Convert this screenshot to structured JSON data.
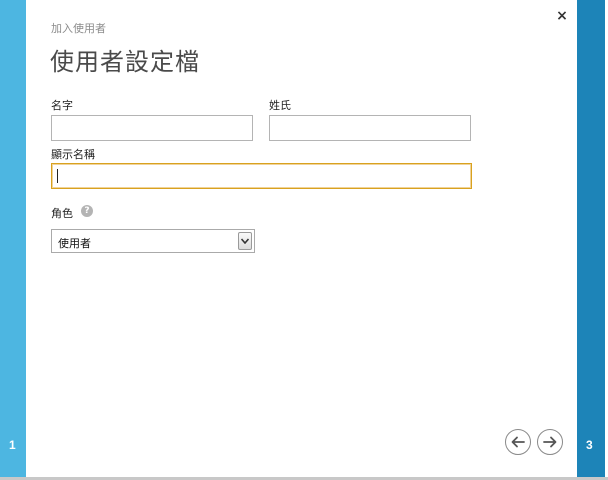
{
  "wizard": {
    "steps": {
      "current": "1",
      "next": "3"
    },
    "breadcrumb": "加入使用者",
    "title": "使用者設定檔",
    "close_symbol": "×"
  },
  "form": {
    "first_name": {
      "label": "名字",
      "value": "",
      "placeholder": ""
    },
    "last_name": {
      "label": "姓氏",
      "value": "",
      "placeholder": ""
    },
    "display_name": {
      "label": "顯示名稱",
      "value": "",
      "placeholder": ""
    },
    "role": {
      "label": "角色",
      "selected": "使用者",
      "help_symbol": "?"
    }
  },
  "icons": {
    "close": "close-icon",
    "help": "question-icon",
    "dropdown": "chevron-down-icon",
    "prev": "arrow-left-icon",
    "next": "arrow-right-icon"
  },
  "colors": {
    "left_bar": "#4db6e1",
    "right_bar": "#1d84b8",
    "focus_border": "#d9a21f"
  }
}
